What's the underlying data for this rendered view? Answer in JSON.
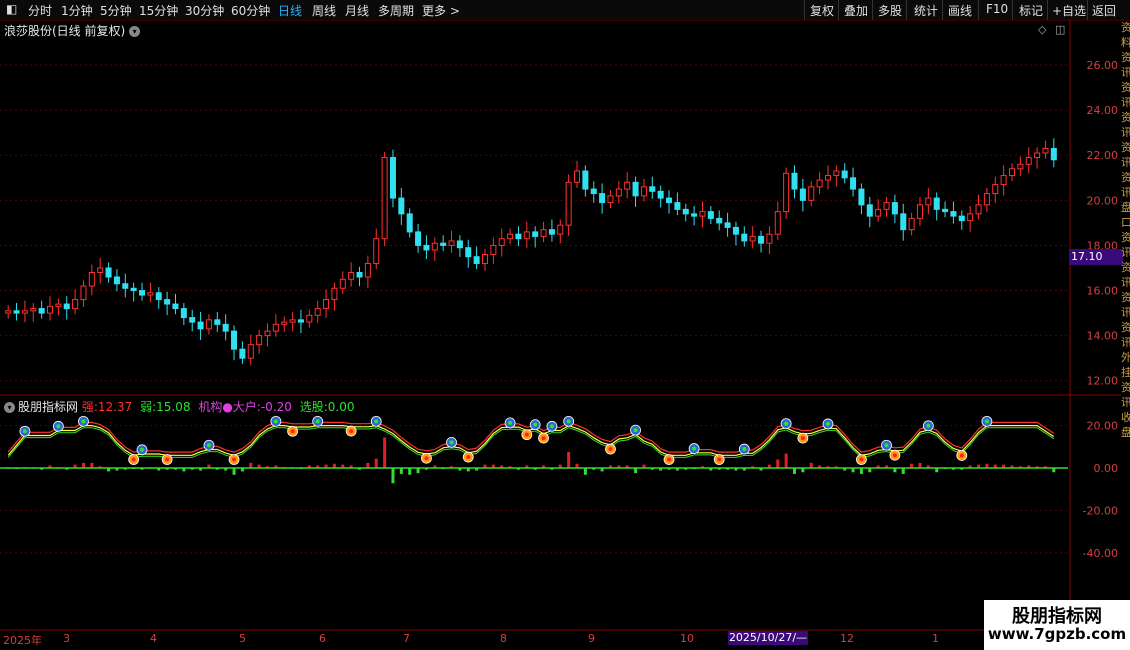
{
  "toolbar": {
    "timeframes": [
      "分时",
      "1分钟",
      "5分钟",
      "15分钟",
      "30分钟",
      "60分钟",
      "日线",
      "周线",
      "月线",
      "多周期",
      "更多 >"
    ],
    "active_timeframe": "日线",
    "right_buttons": [
      "复权",
      "叠加",
      "多股",
      "统计",
      "画线",
      "F10",
      "标记",
      "+自选",
      "返回"
    ]
  },
  "main_chart": {
    "title": "浪莎股份(日线 前复权)",
    "y_ticks": [
      "26.00",
      "24.00",
      "22.00",
      "20.00",
      "18.00",
      "16.00",
      "14.00",
      "12.00"
    ],
    "current_price": "17.10"
  },
  "indicator": {
    "name": "股朋指标网",
    "strong_label": "强:",
    "strong_value": "12.37",
    "weak_label": "弱:",
    "weak_value": "15.08",
    "inst_label": "机构●大户:",
    "inst_value": "-0.20",
    "pick_label": "选股:",
    "pick_value": "0.00",
    "y_ticks": [
      "20.00",
      "0.00",
      "-20.00",
      "-40.00"
    ]
  },
  "x_axis": {
    "labels": [
      "2025年",
      "3",
      "4",
      "5",
      "6",
      "7",
      "8",
      "9",
      "10",
      "11",
      "12",
      "1"
    ],
    "cursor_date": "2025/10/27/—"
  },
  "side_strip_text": "资料资讯资讯资讯资讯资讯盘口资讯资讯资讯资讯外挂资讯收盘",
  "watermark": {
    "title": "股朋指标网",
    "url": "www.7gpzb.com"
  },
  "colors": {
    "up": "#ff3030",
    "down": "#30e0f0",
    "grid": "#5a0000",
    "strong_line": "#ff3030",
    "weak_line": "#ffff40",
    "inst_pos": "#e02020",
    "inst_neg": "#30e030",
    "label_strong": "#ff3030",
    "label_weak": "#30e030",
    "label_inst": "#e040e0",
    "label_pick": "#30e030"
  },
  "chart_data": {
    "type": "candlestick",
    "symbol": "浪莎股份",
    "price_range": [
      11.5,
      27.2
    ],
    "closes": [
      15.1,
      15.0,
      15.1,
      15.2,
      15.0,
      15.3,
      15.4,
      15.2,
      15.6,
      16.2,
      16.8,
      17.0,
      16.6,
      16.3,
      16.1,
      16.0,
      15.8,
      15.9,
      15.6,
      15.4,
      15.2,
      14.8,
      14.6,
      14.3,
      14.7,
      14.5,
      14.2,
      13.4,
      13.0,
      13.6,
      14.0,
      14.2,
      14.5,
      14.6,
      14.7,
      14.6,
      14.9,
      15.2,
      15.6,
      16.1,
      16.5,
      16.8,
      16.6,
      17.2,
      18.3,
      21.9,
      20.1,
      19.4,
      18.6,
      18.0,
      17.8,
      18.1,
      18.0,
      18.2,
      17.9,
      17.5,
      17.2,
      17.6,
      18.0,
      18.3,
      18.5,
      18.3,
      18.6,
      18.4,
      18.7,
      18.5,
      18.9,
      20.8,
      21.3,
      20.5,
      20.3,
      19.9,
      20.2,
      20.5,
      20.8,
      20.2,
      20.6,
      20.4,
      20.1,
      19.9,
      19.6,
      19.4,
      19.3,
      19.5,
      19.2,
      19.0,
      18.8,
      18.5,
      18.2,
      18.4,
      18.1,
      18.5,
      19.5,
      21.2,
      20.5,
      20.0,
      20.6,
      20.9,
      21.1,
      21.3,
      21.0,
      20.5,
      19.8,
      19.3,
      19.6,
      19.9,
      19.4,
      18.7,
      19.2,
      19.8,
      20.1,
      19.6,
      19.5,
      19.3,
      19.1,
      19.4,
      19.8,
      20.3,
      20.7,
      21.1,
      21.4,
      21.6,
      21.9,
      22.1,
      22.3,
      21.8
    ]
  }
}
